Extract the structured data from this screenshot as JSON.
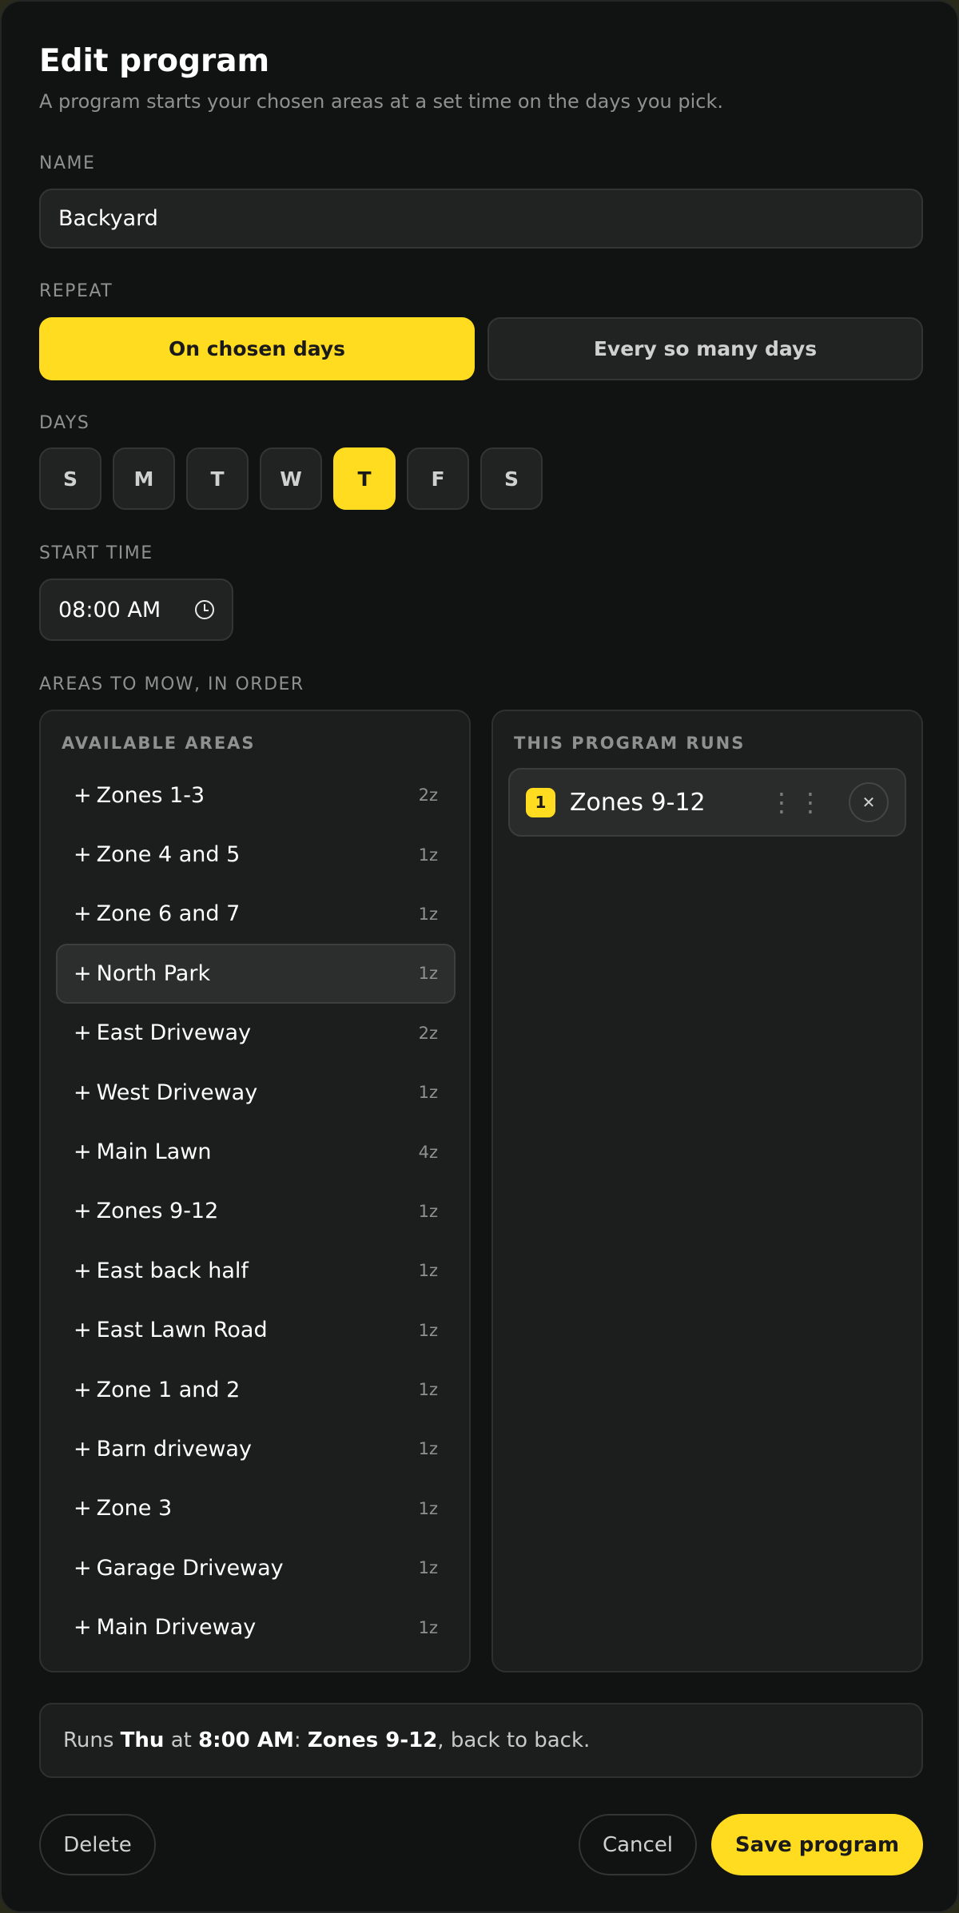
{
  "header": {
    "title": "Edit program",
    "subtitle": "A program starts your chosen areas at a set time on the days you pick."
  },
  "name_field": {
    "label": "NAME",
    "value": "Backyard"
  },
  "repeat": {
    "label": "REPEAT",
    "options": [
      "On chosen days",
      "Every so many days"
    ],
    "selected": 0
  },
  "days": {
    "label": "DAYS",
    "items": [
      "S",
      "M",
      "T",
      "W",
      "T",
      "F",
      "S"
    ],
    "selected": [
      4
    ]
  },
  "start_time": {
    "label": "START TIME",
    "value": "08:00 AM"
  },
  "areas": {
    "label": "AREAS TO MOW, IN ORDER",
    "available_title": "AVAILABLE AREAS",
    "available": [
      {
        "name": "Zones 1-3",
        "count": "2z"
      },
      {
        "name": "Zone 4 and 5",
        "count": "1z"
      },
      {
        "name": "Zone 6 and 7",
        "count": "1z"
      },
      {
        "name": "North Park",
        "count": "1z"
      },
      {
        "name": "East Driveway",
        "count": "2z"
      },
      {
        "name": "West Driveway",
        "count": "1z"
      },
      {
        "name": "Main Lawn",
        "count": "4z"
      },
      {
        "name": "Zones 9-12",
        "count": "1z"
      },
      {
        "name": "East back half",
        "count": "1z"
      },
      {
        "name": "East Lawn Road",
        "count": "1z"
      },
      {
        "name": "Zone 1 and 2",
        "count": "1z"
      },
      {
        "name": "Barn driveway",
        "count": "1z"
      },
      {
        "name": "Zone 3",
        "count": "1z"
      },
      {
        "name": "Garage Driveway",
        "count": "1z"
      },
      {
        "name": "Main Driveway",
        "count": "1z"
      }
    ],
    "hovered_index": 3,
    "runs_title": "THIS PROGRAM RUNS",
    "runs": [
      {
        "order": "1",
        "name": "Zones 9-12"
      }
    ]
  },
  "summary": {
    "prefix": "Runs ",
    "day": "Thu",
    "at": " at ",
    "time": "8:00 AM",
    "colon": ": ",
    "areas": "Zones 9-12",
    "suffix": ", back to back."
  },
  "footer": {
    "delete_label": "Delete",
    "cancel_label": "Cancel",
    "save_label": "Save program"
  },
  "colors": {
    "accent": "#ffdc1f",
    "background": "#111312",
    "surface": "#212322"
  }
}
